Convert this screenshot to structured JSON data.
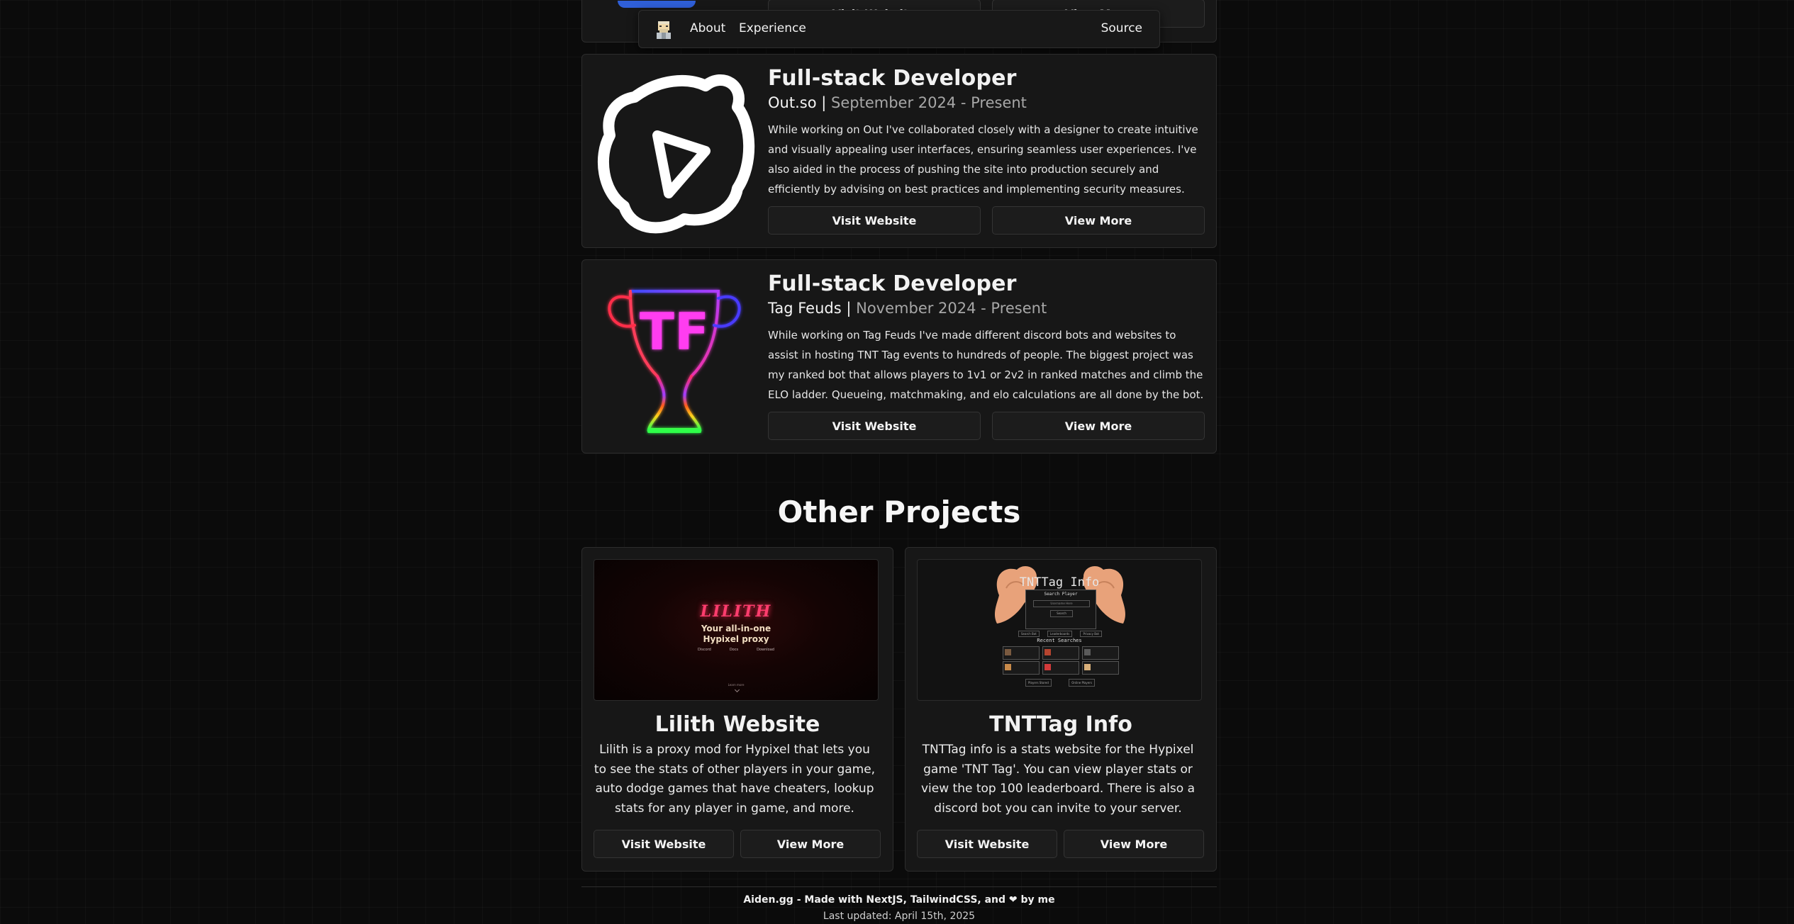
{
  "nav": {
    "about": "About",
    "experience": "Experience",
    "source": "Source"
  },
  "top_card": {
    "visit_label": "Visit Website",
    "more_label": "View More"
  },
  "experience": [
    {
      "title": "Full-stack Developer",
      "company": "Out.so",
      "separator": "|",
      "dates": "September 2024 - Present",
      "description": "While working on Out I've collaborated closely with a designer to create intuitive and visually appealing user interfaces, ensuring seamless user experiences. I've also aided in the process of pushing the site into production securely and efficiently by advising on best practices and implementing security measures.",
      "visit_label": "Visit Website",
      "more_label": "View More",
      "logo_icon": "out-play-icon"
    },
    {
      "title": "Full-stack Developer",
      "company": "Tag Feuds",
      "separator": "|",
      "dates": "November 2024 - Present",
      "description": "While working on Tag Feuds I've made different discord bots and websites to assist in hosting TNT Tag events to hundreds of people. The biggest project was my ranked bot that allows players to 1v1 or 2v2 in ranked matches and climb the ELO ladder. Queueing, matchmaking, and elo calculations are all done by the bot.",
      "visit_label": "Visit Website",
      "more_label": "View More",
      "logo_text": "TF"
    }
  ],
  "projects_heading": "Other Projects",
  "projects": [
    {
      "title": "Lilith Website",
      "description": "Lilith is a proxy mod for Hypixel that lets you to see the stats of other players in your game, auto dodge games that have cheaters, lookup stats for any player in game, and more.",
      "visit_label": "Visit Website",
      "more_label": "View More",
      "preview": {
        "logo": "LILITH",
        "tagline_1": "Your all-in-one",
        "tagline_2": "Hypixel proxy",
        "links": [
          "Discord",
          "Docs",
          "Download"
        ],
        "scroll_hint": "Learn more"
      }
    },
    {
      "title": "TNTTag Info",
      "description": "TNTTag info is a stats website for the Hypixel game 'TNT Tag'. You can view player stats or view the top 100 leaderboard. There is also a discord bot you can invite to your server.",
      "visit_label": "Visit Website",
      "more_label": "View More",
      "preview": {
        "logo": "TNTTag Info",
        "search_label": "Search Player",
        "search_placeholder": "Username Here",
        "search_button": "Search",
        "buttons": [
          "Search Bot",
          "Leaderboards",
          "Privacy Bot"
        ],
        "recent_label": "Recent Searches",
        "stat_1": "Players Stored",
        "stat_2": "Online Players"
      }
    }
  ],
  "footer": {
    "line1": "Aiden.gg - Made with NextJS, TailwindCSS, and ❤ by me",
    "line2": "Last updated: April 15th, 2025"
  },
  "colors": {
    "background": "#0b0b0b",
    "card": "#171717",
    "button": "#1c1c1c",
    "muted_text": "#a7a7a7",
    "lilith_pink": "#ff3d6e",
    "tf_magenta": "#ff3cf0"
  }
}
